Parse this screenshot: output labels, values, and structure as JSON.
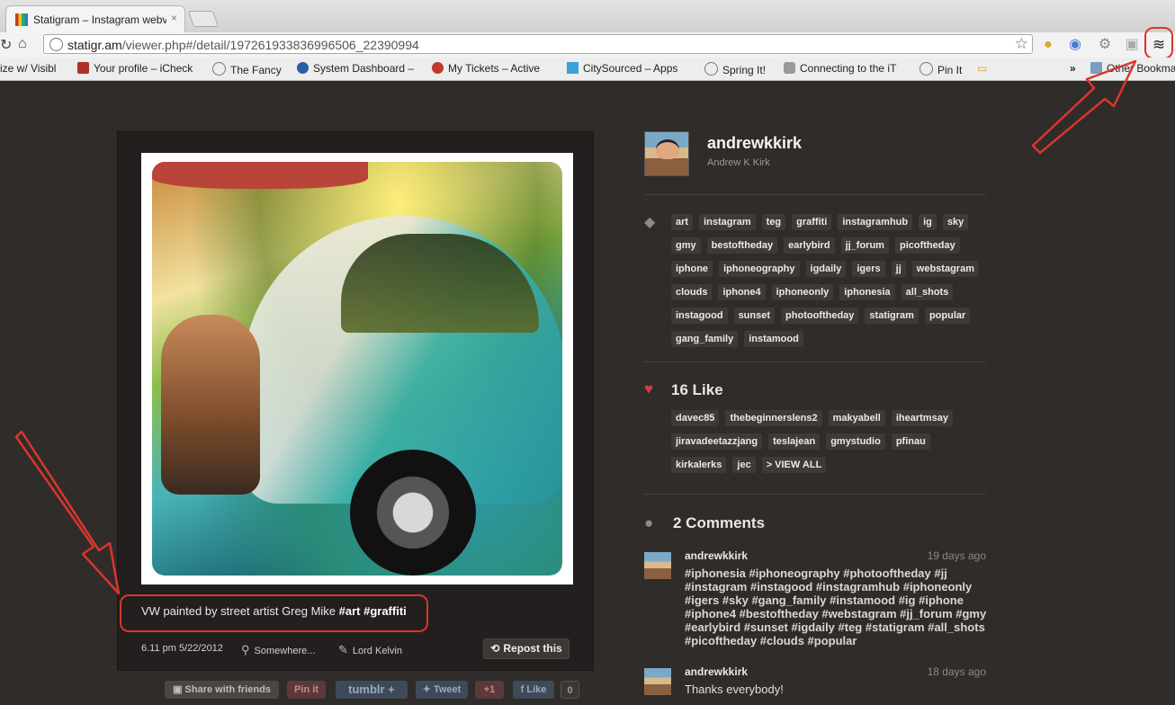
{
  "browser": {
    "tab_title": "Statigram – Instagram webvi",
    "tab_close": "×",
    "url_host": "statigr.am",
    "url_path": "/viewer.php#/detail/197261933836996506_22390994",
    "star": "☆",
    "bookmarks": [
      {
        "label": "ize w/ Visibl",
        "icon": "none"
      },
      {
        "label": "Your profile – iCheck",
        "icon": "check-icon",
        "color": "#b0302a"
      },
      {
        "label": "The Fancy",
        "icon": "globe-icon",
        "color": "#777777"
      },
      {
        "label": "System Dashboard –",
        "icon": "star-icon",
        "color": "#2a5fa8"
      },
      {
        "label": "My Tickets – Active",
        "icon": "bug-icon",
        "color": "#c0392b"
      },
      {
        "label": "CitySourced – Apps",
        "icon": "play-icon",
        "color": "#3aa0d8"
      },
      {
        "label": "Spring It!",
        "icon": "globe-icon",
        "color": "#777777"
      },
      {
        "label": "Connecting to the iT",
        "icon": "apple-icon",
        "color": "#999999"
      },
      {
        "label": "Pin It",
        "icon": "globe-icon",
        "color": "#777777"
      }
    ],
    "more": "»",
    "other_bookmarks": "Other Bookmar"
  },
  "photo": {
    "caption_text": "VW painted by street artist Greg Mike ",
    "caption_tags": "#art #graffiti",
    "time": "6.11 pm 5/22/2012",
    "location": "Somewhere...",
    "filter": "Lord Kelvin",
    "repost_label": "Repost this"
  },
  "share": {
    "share_with_friends": "Share with friends",
    "pinit": "Pin it",
    "tumblr": "tumblr",
    "tumblr_plus": "+",
    "tweet": "Tweet",
    "gplus": "+1",
    "like": "Like",
    "like_count": "0"
  },
  "user": {
    "username": "andrewkkirk",
    "fullname": "Andrew K Kirk"
  },
  "tags": [
    "art",
    "instagram",
    "teg",
    "graffiti",
    "instagramhub",
    "ig",
    "sky",
    "gmy",
    "bestoftheday",
    "earlybird",
    "jj_forum",
    "picoftheday",
    "iphone",
    "iphoneography",
    "igdaily",
    "igers",
    "jj",
    "webstagram",
    "clouds",
    "iphone4",
    "iphoneonly",
    "iphonesia",
    "all_shots",
    "instagood",
    "sunset",
    "photooftheday",
    "statigram",
    "popular",
    "gang_family",
    "instamood"
  ],
  "likes": {
    "title": "16 Like",
    "users": [
      "davec85",
      "thebeginnerslens2",
      "makyabell",
      "iheartmsay",
      "jiravadeetazzjang",
      "teslajean",
      "gmystudio",
      "pfinau",
      "kirkalerks",
      "jec",
      "> VIEW ALL"
    ]
  },
  "comments": {
    "title": "2 Comments",
    "items": [
      {
        "user": "andrewkkirk",
        "time": "19 days ago",
        "text": "#iphonesia #iphoneography #photooftheday #jj #instagram #instagood #instagramhub #iphoneonly #igers #sky #gang_family #instamood #ig #iphone #iphone4 #bestoftheday #webstagram #jj_forum #gmy #earlybird #sunset #igdaily #teg #statigram #all_shots #picoftheday #clouds #popular"
      },
      {
        "user": "andrewkkirk",
        "time": "18 days ago",
        "text": "Thanks everybody!"
      }
    ]
  },
  "colors": {
    "accent_red": "#d9362b",
    "heart": "#d83a44",
    "bg": "#2f2c2a"
  }
}
